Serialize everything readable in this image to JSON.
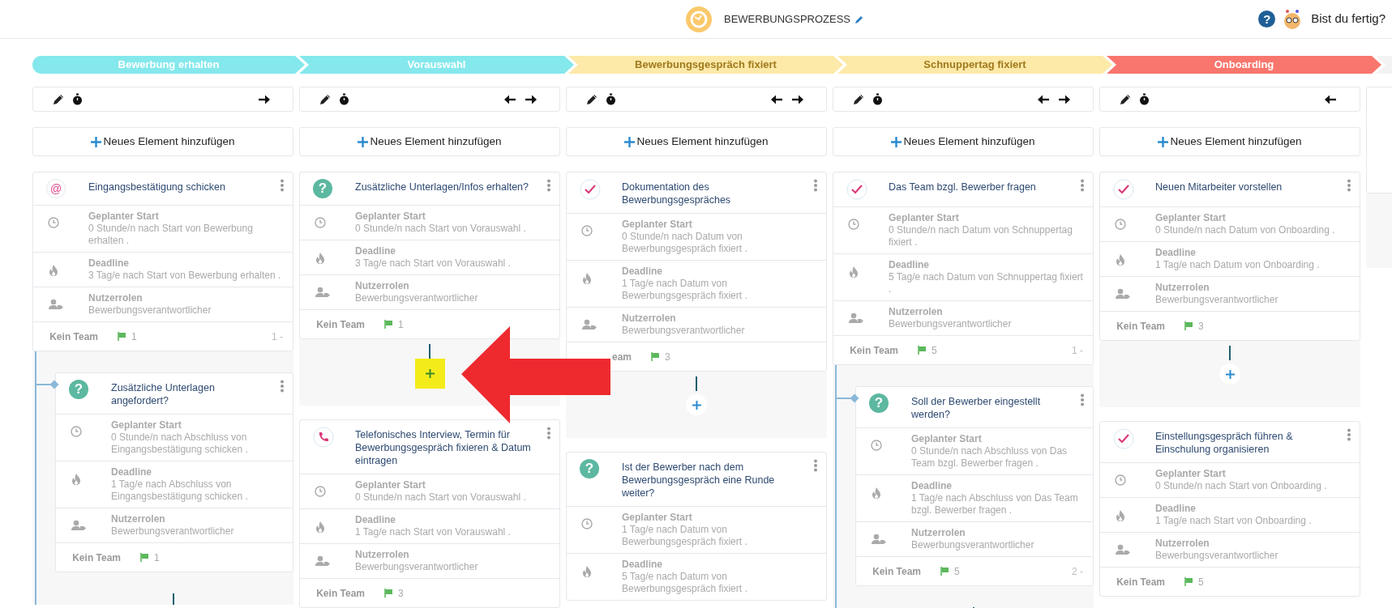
{
  "header": {
    "title": "BEWERBUNGSPROZESS",
    "help_symbol": "?",
    "prompt": "Bist du fertig?"
  },
  "phases": [
    {
      "label": "Bewerbung erhalten",
      "color": "#84e8ec"
    },
    {
      "label": "Vorauswahl",
      "color": "#84e8ec"
    },
    {
      "label": "Bewerbungsgespräch fixiert",
      "color": "#fde9a8"
    },
    {
      "label": "Schnuppertag fixiert",
      "color": "#fde9a8"
    },
    {
      "label": "Onboarding",
      "color": "#f8766d"
    },
    {
      "color": "#f3f3f3"
    }
  ],
  "columns": [
    {
      "kind": "full",
      "move_left": false,
      "move_right": true,
      "add_label": "Neues Element hinzufügen",
      "stack": [
        {
          "kind": "card",
          "icon": {
            "kind": "mention",
            "symbol": "@"
          },
          "title": "Eingangsbestätigung schicken",
          "rows": [
            {
              "kind": "start",
              "label": "Geplanter Start",
              "value": "0 Stunde/n nach Start von Bewerbung erhalten ."
            },
            {
              "kind": "deadline",
              "label": "Deadline",
              "value": "3 Tag/e nach Start von Bewerbung erhalten ."
            },
            {
              "kind": "roles",
              "label": "Nutzerrolen",
              "value": "Bewerbungsverantwortlicher"
            }
          ],
          "team": "Kein Team",
          "flags": "1",
          "order": "1 -"
        },
        {
          "kind": "branch",
          "card": {
            "icon": {
              "kind": "question",
              "symbol": "?"
            },
            "title": "Zusätzliche Unterlagen angefordert?",
            "rows": [
              {
                "kind": "start",
                "label": "Geplanter Start",
                "value": "0 Stunde/n nach Abschluss von Eingangsbestätigung schicken ."
              },
              {
                "kind": "deadline",
                "label": "Deadline",
                "value": "1 Tag/e nach Abschluss von Eingangsbestätigung schicken ."
              },
              {
                "kind": "roles",
                "label": "Nutzerrolen",
                "value": "Bewerbungsverantwortlicher"
              }
            ],
            "team": "Kein Team",
            "flags": "1"
          }
        }
      ]
    },
    {
      "kind": "full",
      "move_left": true,
      "move_right": true,
      "add_label": "Neues Element hinzufügen",
      "stack": [
        {
          "kind": "card",
          "icon": {
            "kind": "question",
            "symbol": "?"
          },
          "title": "Zusätzliche Unterlagen/Infos erhalten?",
          "rows": [
            {
              "kind": "start",
              "label": "Geplanter Start",
              "value": "0 Stunde/n nach Start von Vorauswahl ."
            },
            {
              "kind": "deadline",
              "label": "Deadline",
              "value": "3 Tag/e nach Start von Vorauswahl ."
            },
            {
              "kind": "roles",
              "label": "Nutzerrolen",
              "value": "Bewerbungsverantwortlicher"
            }
          ],
          "team": "Kein Team",
          "flags": "1"
        },
        {
          "kind": "add_zone",
          "highlighted": true
        },
        {
          "kind": "card",
          "icon": {
            "kind": "call"
          },
          "title": "Telefonisches Interview, Termin für Bewerbungsgespräch fixieren & Datum eintragen",
          "rows": [
            {
              "kind": "start",
              "label": "Geplanter Start",
              "value": "0 Stunde/n nach Start von Vorauswahl ."
            },
            {
              "kind": "deadline",
              "label": "Deadline",
              "value": "1 Tag/e nach Start von Vorauswahl ."
            },
            {
              "kind": "roles",
              "label": "Nutzerrolen",
              "value": "Bewerbungsverantwortlicher"
            }
          ],
          "team": "Kein Team",
          "flags": "3"
        }
      ]
    },
    {
      "kind": "full",
      "move_left": true,
      "move_right": true,
      "add_label": "Neues Element hinzufügen",
      "stack": [
        {
          "kind": "card",
          "icon": {
            "kind": "task"
          },
          "title": "Dokumentation des Bewerbungsgespräches",
          "rows": [
            {
              "kind": "start",
              "label": "Geplanter Start",
              "value": "0 Stunde/n nach Datum von Bewerbungsgespräch fixiert ."
            },
            {
              "kind": "deadline",
              "label": "Deadline",
              "value": "1 Tag/e nach Datum von Bewerbungsgespräch fixiert ."
            },
            {
              "kind": "roles",
              "label": "Nutzerrolen",
              "value": "Bewerbungsverantwortlicher"
            }
          ],
          "team": "eam",
          "flags": "3"
        },
        {
          "kind": "add_zone",
          "highlighted": false
        },
        {
          "kind": "card",
          "icon": {
            "kind": "question",
            "symbol": "?"
          },
          "title": "Ist der Bewerber nach dem Bewerbungsgespräch eine Runde weiter?",
          "rows": [
            {
              "kind": "start",
              "label": "Geplanter Start",
              "value": "1 Tag/e nach Datum von Bewerbungsgespräch fixiert ."
            },
            {
              "kind": "deadline",
              "label": "Deadline",
              "value": "5 Tag/e nach Datum von Bewerbungsgespräch fixiert ."
            }
          ]
        }
      ]
    },
    {
      "kind": "full",
      "move_left": true,
      "move_right": true,
      "add_label": "Neues Element hinzufügen",
      "stack": [
        {
          "kind": "card",
          "icon": {
            "kind": "task"
          },
          "title": "Das Team bzgl. Bewerber fragen",
          "rows": [
            {
              "kind": "start",
              "label": "Geplanter Start",
              "value": "0 Stunde/n nach Datum von Schnuppertag fixiert ."
            },
            {
              "kind": "deadline",
              "label": "Deadline",
              "value": "5 Tag/e nach Datum von Schnuppertag fixiert ."
            },
            {
              "kind": "roles",
              "label": "Nutzerrolen",
              "value": "Bewerbungsverantwortlicher"
            }
          ],
          "team": "Kein Team",
          "flags": "5",
          "order": "1 -"
        },
        {
          "kind": "branch",
          "card": {
            "icon": {
              "kind": "question",
              "symbol": "?"
            },
            "title": "Soll der Bewerber eingestellt werden?",
            "rows": [
              {
                "kind": "start",
                "label": "Geplanter Start",
                "value": "0 Stunde/n nach Abschluss von Das Team bzgl. Bewerber fragen ."
              },
              {
                "kind": "deadline",
                "label": "Deadline",
                "value": "1 Tag/e nach Abschluss von Das Team bzgl. Bewerber fragen ."
              },
              {
                "kind": "roles",
                "label": "Nutzerrolen",
                "value": "Bewerbungsverantwortlicher"
              }
            ],
            "team": "Kein Team",
            "flags": "5",
            "order": "2 -"
          }
        }
      ]
    },
    {
      "kind": "full",
      "move_left": true,
      "move_right": false,
      "add_label": "Neues Element hinzufügen",
      "stack": [
        {
          "kind": "card",
          "icon": {
            "kind": "task"
          },
          "title": "Neuen Mitarbeiter vorstellen",
          "rows": [
            {
              "kind": "start",
              "label": "Geplanter Start",
              "value": "0 Stunde/n nach Datum von Onboarding ."
            },
            {
              "kind": "deadline",
              "label": "Deadline",
              "value": "1 Tag/e nach Datum von Onboarding ."
            },
            {
              "kind": "roles",
              "label": "Nutzerrolen",
              "value": "Bewerbungsverantwortlicher"
            }
          ],
          "team": "Kein Team",
          "flags": "3"
        },
        {
          "kind": "add_zone",
          "highlighted": false
        },
        {
          "kind": "card",
          "icon": {
            "kind": "task"
          },
          "title": "Einstellungsgespräch führen & Einschulung organisieren",
          "rows": [
            {
              "kind": "start",
              "label": "Geplanter Start",
              "value": "0 Stunde/n nach Start von Onboarding ."
            },
            {
              "kind": "deadline",
              "label": "Deadline",
              "value": "1 Tag/e nach Start von Onboarding ."
            },
            {
              "kind": "roles",
              "label": "Nutzerrolen",
              "value": "Bewerbungsverantwortlicher"
            }
          ],
          "team": "Kein Team",
          "flags": "5"
        }
      ]
    },
    {
      "kind": "partial"
    }
  ],
  "annotation": {
    "kind": "arrow"
  }
}
